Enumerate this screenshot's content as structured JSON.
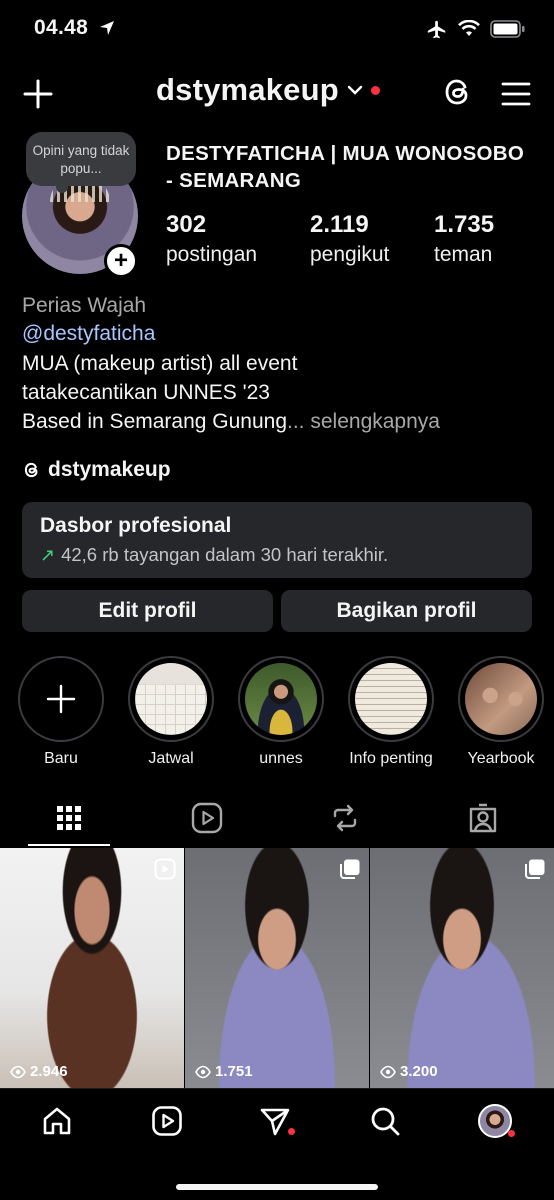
{
  "status_bar": {
    "time": "04.48"
  },
  "header": {
    "username": "dstymakeup"
  },
  "profile": {
    "note": "Opini yang tidak popu...",
    "full_name": "DESTYFATICHA | MUA WONOSOBO - SEMARANG",
    "stats": [
      {
        "value": "302",
        "label": "postingan"
      },
      {
        "value": "2.119",
        "label": "pengikut"
      },
      {
        "value": "1.735",
        "label": "teman"
      }
    ],
    "category": "Perias Wajah",
    "mention": "@destyfaticha",
    "bio_lines": [
      "MUA (makeup artist) all event",
      "tatakecantikan UNNES '23",
      "Based in Semarang Gunung"
    ],
    "bio_ellipsis": "...",
    "more_label": "selengkapnya",
    "threads_handle": "dstymakeup"
  },
  "dashboard": {
    "title": "Dasbor profesional",
    "subtitle": "42,6 rb tayangan dalam 30 hari terakhir."
  },
  "actions": {
    "edit": "Edit profil",
    "share": "Bagikan profil"
  },
  "highlights": [
    {
      "label": "Baru",
      "icon": "plus-icon"
    },
    {
      "label": "Jatwal"
    },
    {
      "label": "unnes"
    },
    {
      "label": "Info penting"
    },
    {
      "label": "Yearbook"
    }
  ],
  "tabs": [
    "grid-icon",
    "reels-icon",
    "reposts-icon",
    "tagged-icon"
  ],
  "posts": [
    {
      "views": "2.946",
      "type": "reel"
    },
    {
      "views": "1.751",
      "type": "carousel"
    },
    {
      "views": "3.200",
      "type": "carousel"
    }
  ],
  "bottom_nav": [
    "home-icon",
    "reels-icon",
    "messages-icon",
    "search-icon",
    "profile-avatar"
  ],
  "colors": {
    "background": "#000000",
    "surface": "#25272b",
    "link": "#a8c5ff",
    "notification": "#ff3040",
    "trend": "#3fd27a"
  }
}
